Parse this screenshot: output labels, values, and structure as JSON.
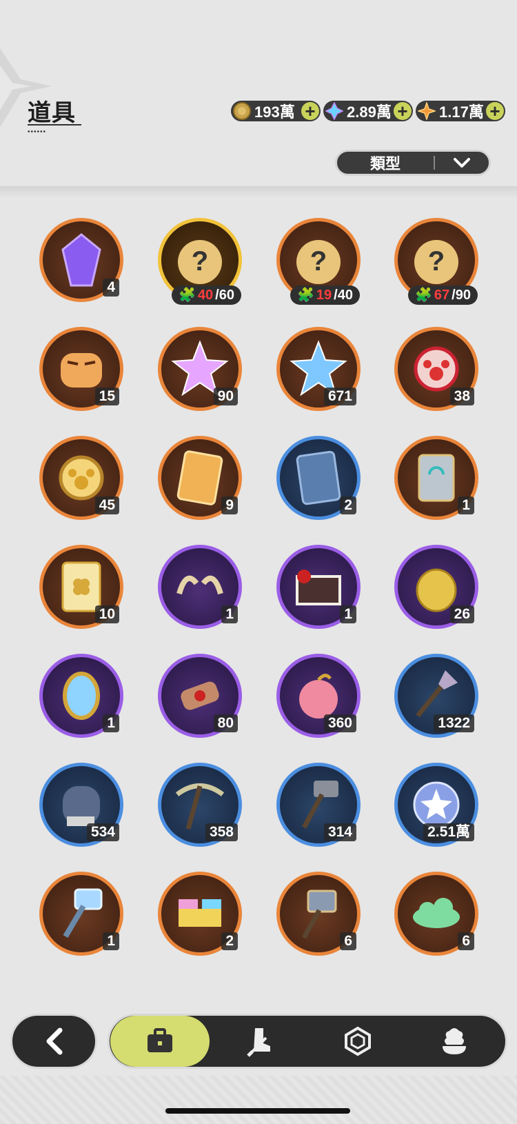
{
  "header": {
    "title": "道具",
    "currencies": [
      {
        "name": "gold-coin",
        "value": "193萬",
        "icon": "coin-icon",
        "color": "#c8a24a"
      },
      {
        "name": "crystal",
        "value": "2.89萬",
        "icon": "crystal-icon",
        "color": "#6ad4ff"
      },
      {
        "name": "star-shard",
        "value": "1.17萬",
        "icon": "star-shard-icon",
        "color": "#f29a3a"
      }
    ],
    "plus_label": "+",
    "filter_label": "類型"
  },
  "items": [
    {
      "icon": "purple-crystal-gem-icon",
      "rarity": "orange",
      "count": "4"
    },
    {
      "icon": "mystery-fragment-icon",
      "rarity": "gold",
      "frag_have": "40",
      "frag_total": "/60"
    },
    {
      "icon": "mystery-fragment-icon",
      "rarity": "orange",
      "frag_have": "19",
      "frag_total": "/40"
    },
    {
      "icon": "mystery-fragment-icon",
      "rarity": "orange",
      "frag_have": "67",
      "frag_total": "/90"
    },
    {
      "icon": "tiger-fragment-icon",
      "rarity": "orange",
      "count": "15",
      "frag": true
    },
    {
      "icon": "pink-star-crystal-icon",
      "rarity": "orange",
      "count": "90"
    },
    {
      "icon": "blue-star-crystal-icon",
      "rarity": "orange",
      "count": "671"
    },
    {
      "icon": "red-paw-charm-icon",
      "rarity": "orange",
      "count": "38"
    },
    {
      "icon": "gold-paw-charm-icon",
      "rarity": "orange",
      "count": "45"
    },
    {
      "icon": "gold-character-card-icon",
      "rarity": "orange",
      "count": "9"
    },
    {
      "icon": "blue-character-card-icon",
      "rarity": "blue",
      "count": "2"
    },
    {
      "icon": "exchange-card-icon",
      "rarity": "orange",
      "count": "1"
    },
    {
      "icon": "clover-card-icon",
      "rarity": "orange",
      "count": "10"
    },
    {
      "icon": "horn-ornament-icon",
      "rarity": "purple",
      "count": "1"
    },
    {
      "icon": "gift-box-icon",
      "rarity": "purple",
      "count": "1"
    },
    {
      "icon": "gold-bell-icon",
      "rarity": "purple",
      "count": "26"
    },
    {
      "icon": "magic-mirror-icon",
      "rarity": "purple",
      "count": "1"
    },
    {
      "icon": "scroll-icon",
      "rarity": "purple",
      "count": "80"
    },
    {
      "icon": "peach-fruit-icon",
      "rarity": "purple",
      "count": "360"
    },
    {
      "icon": "shovel-icon",
      "rarity": "blue",
      "count": "1322"
    },
    {
      "icon": "boxing-glove-icon",
      "rarity": "blue",
      "count": "534"
    },
    {
      "icon": "pickaxe-icon",
      "rarity": "blue",
      "count": "358"
    },
    {
      "icon": "hammer-icon",
      "rarity": "blue",
      "count": "314"
    },
    {
      "icon": "star-orb-icon",
      "rarity": "blue",
      "count": "2.51萬"
    },
    {
      "icon": "ice-hammer-icon",
      "rarity": "orange",
      "count": "1"
    },
    {
      "icon": "building-block-icon",
      "rarity": "orange",
      "count": "2"
    },
    {
      "icon": "spiked-mallet-icon",
      "rarity": "orange",
      "count": "6"
    },
    {
      "icon": "green-cloud-icon",
      "rarity": "orange",
      "count": "6"
    }
  ],
  "nav": {
    "back_icon": "chevron-left-icon",
    "tabs": [
      {
        "name": "tab-items",
        "icon": "briefcase-icon",
        "active": true
      },
      {
        "name": "tab-equipment",
        "icon": "boot-sword-icon",
        "active": false
      },
      {
        "name": "tab-gems",
        "icon": "hexagon-gem-icon",
        "active": false
      },
      {
        "name": "tab-food",
        "icon": "cream-dessert-icon",
        "active": false
      }
    ]
  },
  "colors": {
    "orange_ring": "#e9853a",
    "gold_ring": "#f2c23a",
    "blue_ring": "#4b8ee0",
    "purple_ring": "#9a5ee6",
    "active_tab": "#d5dc70",
    "fragment_red": "#ff3d3d"
  }
}
